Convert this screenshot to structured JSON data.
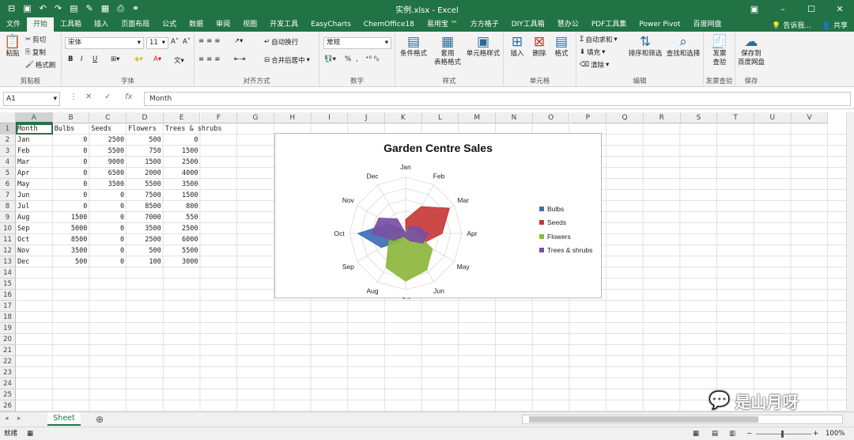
{
  "titlebar": {
    "title": "实例.xlsx - Excel",
    "min": "–",
    "restore": "☐",
    "close": "✕",
    "ribbon_opts": "▣"
  },
  "tabs": [
    "文件",
    "开始",
    "工具箱",
    "插入",
    "页面布局",
    "公式",
    "数据",
    "审阅",
    "视图",
    "开发工具",
    "EasyCharts",
    "ChemOffice18",
    "易用宝 ™",
    "方方格子",
    "DIY工具箱",
    "慧办公",
    "PDF工具集",
    "Power Pivot",
    "百度网盘"
  ],
  "tell_me": "告诉我...",
  "share": "共享",
  "ribbon": {
    "clipboard": {
      "paste": "粘贴",
      "cut": "剪切",
      "copy": "复制",
      "format_painter": "格式刷",
      "label": "剪贴板"
    },
    "font": {
      "name": "宋体",
      "size": "11",
      "bold": "B",
      "italic": "I",
      "underline": "U",
      "label": "字体"
    },
    "alignment": {
      "wrap": "自动换行",
      "merge": "合并后居中",
      "label": "对齐方式"
    },
    "number": {
      "format": "常规",
      "percent": "%",
      "comma": ",",
      "label": "数字"
    },
    "styles": {
      "conditional": "条件格式",
      "table": "套用\n表格格式",
      "cell": "单元格样式",
      "label": "样式"
    },
    "cells": {
      "insert": "插入",
      "delete": "删除",
      "format": "格式",
      "label": "单元格"
    },
    "editing": {
      "autosum": "自动求和",
      "fill": "填充",
      "clear": "清除",
      "sort": "排序和筛选",
      "find": "查找和选择",
      "label": "编辑"
    },
    "invoice": {
      "check": "发票\n查验",
      "label": "发票查验"
    },
    "save": {
      "save_baidu": "保存到\n百度网盘",
      "label": "保存"
    }
  },
  "formula_bar": {
    "name_box": "A1",
    "fx": "fx",
    "value": "Month"
  },
  "columns": [
    "A",
    "B",
    "C",
    "D",
    "E",
    "F",
    "G",
    "H",
    "I",
    "J",
    "K",
    "L",
    "M",
    "N",
    "O",
    "P",
    "Q",
    "R",
    "S",
    "T",
    "U",
    "V"
  ],
  "rows": [
    "1",
    "2",
    "3",
    "4",
    "5",
    "6",
    "7",
    "8",
    "9",
    "10",
    "11",
    "12",
    "13",
    "14",
    "15",
    "16",
    "17",
    "18",
    "19",
    "20",
    "21",
    "22",
    "23",
    "24",
    "25",
    "26"
  ],
  "sheet": {
    "headers": [
      "Month",
      "Bulbs",
      "Seeds",
      "Flowers",
      "Trees & shrubs"
    ],
    "data": [
      [
        "Jan",
        "0",
        "2500",
        "500",
        "0"
      ],
      [
        "Feb",
        "0",
        "5500",
        "750",
        "1500"
      ],
      [
        "Mar",
        "0",
        "9000",
        "1500",
        "2500"
      ],
      [
        "Apr",
        "0",
        "6500",
        "2000",
        "4000"
      ],
      [
        "May",
        "0",
        "3500",
        "5500",
        "3500"
      ],
      [
        "Jun",
        "0",
        "0",
        "7500",
        "1500"
      ],
      [
        "Jul",
        "0",
        "0",
        "8500",
        "800"
      ],
      [
        "Aug",
        "1500",
        "0",
        "7000",
        "550"
      ],
      [
        "Sep",
        "5000",
        "0",
        "3500",
        "2500"
      ],
      [
        "Oct",
        "8500",
        "0",
        "2500",
        "6000"
      ],
      [
        "Nov",
        "3500",
        "0",
        "500",
        "5500"
      ],
      [
        "Dec",
        "500",
        "0",
        "100",
        "3000"
      ]
    ]
  },
  "chart_data": {
    "type": "radar",
    "title": "Garden Centre Sales",
    "categories": [
      "Jan",
      "Feb",
      "Mar",
      "Apr",
      "May",
      "Jun",
      "Jul",
      "Aug",
      "Sep",
      "Oct",
      "Nov",
      "Dec"
    ],
    "rmax": 10000,
    "legend_position": "right",
    "series": [
      {
        "name": "Bulbs",
        "color": "#3d6fb4",
        "values": [
          0,
          0,
          0,
          0,
          0,
          0,
          0,
          1500,
          5000,
          8500,
          3500,
          500
        ]
      },
      {
        "name": "Seeds",
        "color": "#c8383a",
        "values": [
          2500,
          5500,
          9000,
          6500,
          3500,
          0,
          0,
          0,
          0,
          0,
          0,
          0
        ]
      },
      {
        "name": "Flowers",
        "color": "#8db73d",
        "values": [
          500,
          750,
          1500,
          2000,
          5500,
          7500,
          8500,
          7000,
          3500,
          2500,
          500,
          100
        ]
      },
      {
        "name": "Trees & shrubs",
        "color": "#7a4fa3",
        "values": [
          0,
          1500,
          2500,
          4000,
          3500,
          1500,
          800,
          550,
          2500,
          6000,
          5500,
          3000
        ]
      }
    ]
  },
  "sheet_tab": "Sheet",
  "add_sheet": "⊕",
  "status": {
    "ready": "就绪",
    "zoom": "100%"
  },
  "watermark": "是山月呀"
}
